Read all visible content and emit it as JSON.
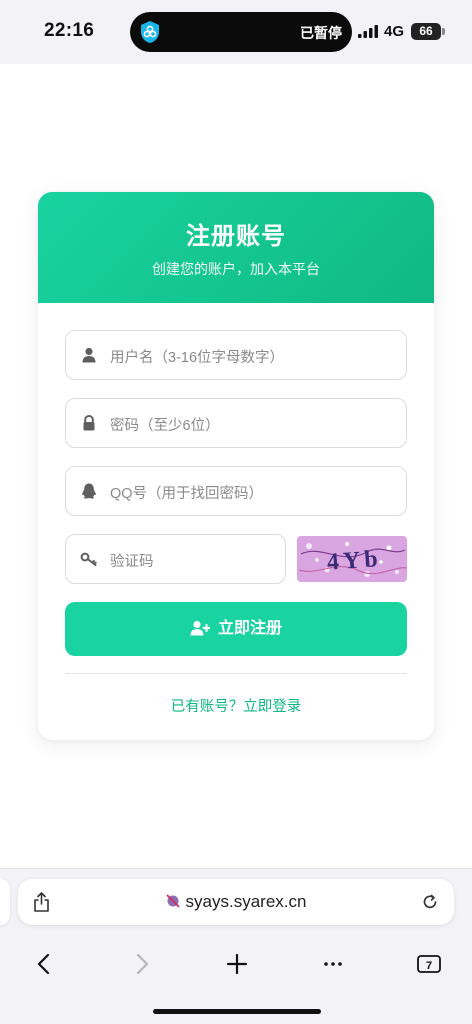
{
  "status_bar": {
    "time": "22:16",
    "island_text": "已暂停",
    "network": "4G",
    "battery": "66"
  },
  "card": {
    "title": "注册账号",
    "subtitle": "创建您的账户，加入本平台"
  },
  "form": {
    "username_placeholder": "用户名（3-16位字母数字）",
    "password_placeholder": "密码（至少6位）",
    "qq_placeholder": "QQ号（用于找回密码）",
    "code_placeholder": "验证码",
    "captcha_text": "4Yb",
    "register_label": "立即注册",
    "login_link": "已有账号？立即登录"
  },
  "browser": {
    "url": "syays.syarex.cn",
    "tab_count": "7"
  },
  "colors": {
    "accent": "#19d3a0",
    "accent_dark": "#10b981"
  }
}
